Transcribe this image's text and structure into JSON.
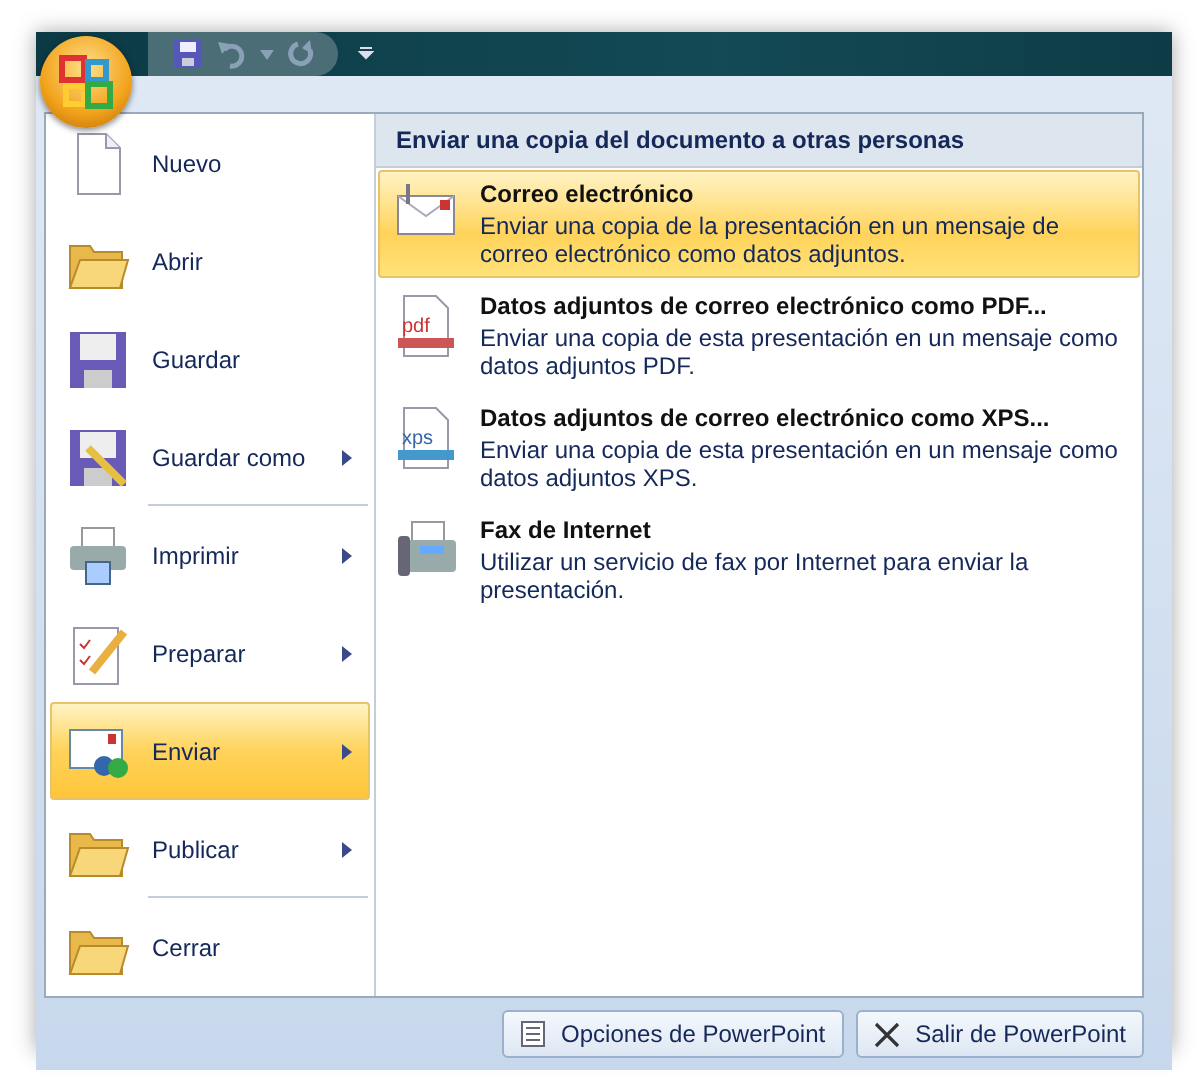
{
  "menu": {
    "items": [
      {
        "label": "Nuevo",
        "has_submenu": false,
        "selected": false,
        "separator_after": false
      },
      {
        "label": "Abrir",
        "has_submenu": false,
        "selected": false,
        "separator_after": false
      },
      {
        "label": "Guardar",
        "has_submenu": false,
        "selected": false,
        "separator_after": false
      },
      {
        "label": "Guardar como",
        "has_submenu": true,
        "selected": false,
        "separator_after": true
      },
      {
        "label": "Imprimir",
        "has_submenu": true,
        "selected": false,
        "separator_after": false
      },
      {
        "label": "Preparar",
        "has_submenu": true,
        "selected": false,
        "separator_after": false
      },
      {
        "label": "Enviar",
        "has_submenu": true,
        "selected": true,
        "separator_after": false
      },
      {
        "label": "Publicar",
        "has_submenu": true,
        "selected": false,
        "separator_after": true
      },
      {
        "label": "Cerrar",
        "has_submenu": false,
        "selected": false,
        "separator_after": false
      }
    ]
  },
  "submenu": {
    "heading": "Enviar una copia del documento a otras personas",
    "items": [
      {
        "title": "Correo electrónico",
        "description": "Enviar una copia de la presentación en un mensaje de correo electrónico como datos adjuntos.",
        "selected": true,
        "kind": "mail"
      },
      {
        "title": "Datos adjuntos de correo electrónico como PDF...",
        "description": "Enviar una copia de esta presentación en un mensaje como datos adjuntos PDF.",
        "selected": false,
        "kind": "pdf",
        "badge": "pdf"
      },
      {
        "title": "Datos adjuntos de correo electrónico como XPS...",
        "description": "Enviar una copia de esta presentación en un mensaje como datos adjuntos XPS.",
        "selected": false,
        "kind": "xps",
        "badge": "xps"
      },
      {
        "title": "Fax de Internet",
        "description": "Utilizar un servicio de fax por Internet para enviar la presentación.",
        "selected": false,
        "kind": "fax"
      }
    ]
  },
  "buttons": [
    {
      "label": "Opciones de PowerPoint",
      "kind": "options"
    },
    {
      "label": "Salir de PowerPoint",
      "kind": "exit"
    }
  ]
}
